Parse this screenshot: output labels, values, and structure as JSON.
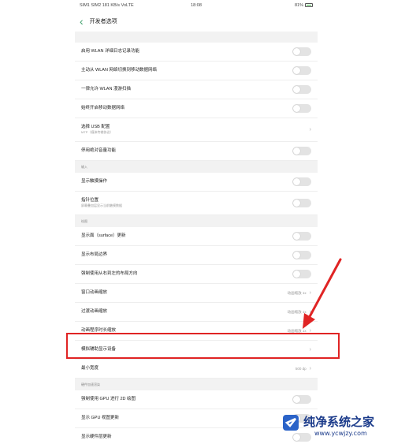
{
  "status_bar": {
    "left": "SIM1 SIM2 181 KB/s VoLTE",
    "time": "18:08",
    "battery": "81%"
  },
  "nav": {
    "title": "开发者选项"
  },
  "rows_a": [
    {
      "label": "启用 WLAN 详细日志记录功能",
      "type": "toggle"
    },
    {
      "label": "主动从 WLAN 网络切换到移动数据网络",
      "type": "toggle"
    },
    {
      "label": "一律允许 WLAN 漫游扫描",
      "type": "toggle"
    },
    {
      "label": "始终开启移动数据网络",
      "type": "toggle"
    },
    {
      "label": "选择 USB 配置",
      "sub": "MTP（媒体传输协议）",
      "type": "chevron"
    },
    {
      "label": "停用绝对音量功能",
      "type": "toggle"
    }
  ],
  "section_input": "输入",
  "rows_b": [
    {
      "label": "显示触摸操作",
      "type": "toggle"
    },
    {
      "label": "指针位置",
      "sub": "屏幕叠加层显示当前触摸数据",
      "type": "toggle"
    }
  ],
  "section_draw": "绘图",
  "rows_c": [
    {
      "label": "显示面（surface）更新",
      "type": "toggle"
    },
    {
      "label": "显示布局边界",
      "type": "toggle"
    },
    {
      "label": "强制使用从右到左的布局方向",
      "type": "toggle"
    },
    {
      "label": "窗口动画缩放",
      "value": "动画缩放 1x",
      "type": "chevron"
    },
    {
      "label": "过渡动画缩放",
      "value": "动画缩放 1x",
      "type": "chevron"
    },
    {
      "label": "动画程序时长缩放",
      "value": "动画缩放 1x",
      "type": "chevron"
    },
    {
      "label": "模拟辅助显示设备",
      "value": "",
      "type": "chevron"
    },
    {
      "label": "最小宽度",
      "value": "500 dp",
      "type": "chevron"
    }
  ],
  "section_hw": "硬件加速渲染",
  "rows_d": [
    {
      "label": "强制使用 GPU 进行 2D 绘图",
      "type": "toggle"
    },
    {
      "label": "显示 GPU 视图更新",
      "type": "toggle"
    },
    {
      "label": "显示硬件层更新",
      "type": "toggle"
    }
  ],
  "watermark": {
    "title": "纯净系统之家",
    "url": "www.ycwjzy.com"
  },
  "colors": {
    "accent": "#3ca06a",
    "highlight": "#e02424"
  }
}
